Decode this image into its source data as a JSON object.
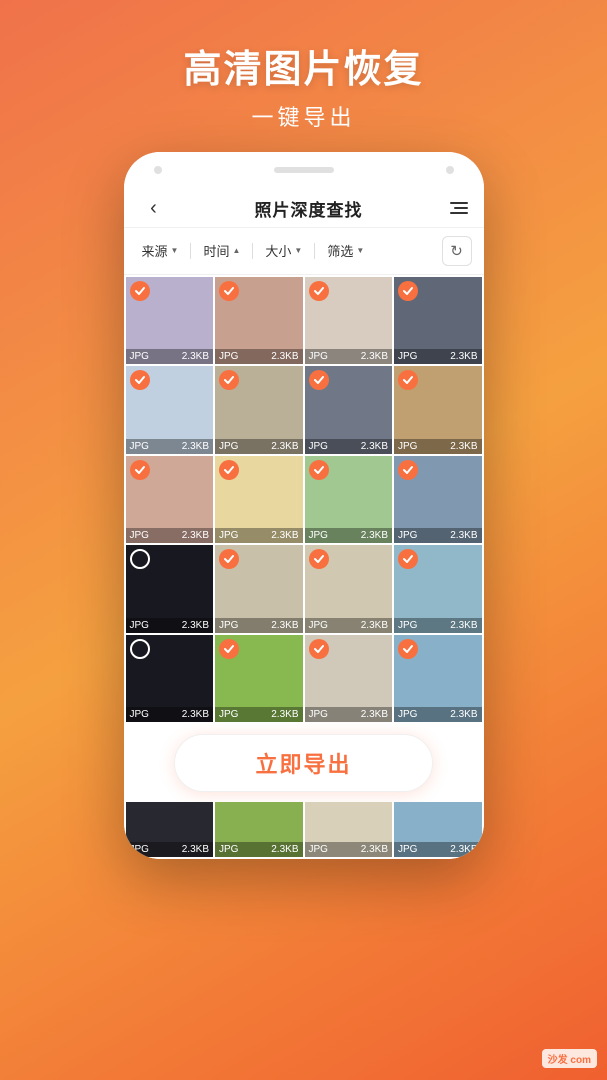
{
  "app": {
    "title": "高清图片恢复",
    "subtitle": "一键导出",
    "header": {
      "back_label": "‹",
      "screen_title": "照片深度查找"
    },
    "filters": [
      {
        "label": "来源",
        "arrow": "▼"
      },
      {
        "label": "时间",
        "arrow": "▲"
      },
      {
        "label": "大小",
        "arrow": "▼"
      },
      {
        "label": "筛选",
        "arrow": "▼"
      }
    ],
    "export_button": "立即导出",
    "grid_items": [
      {
        "checked": true,
        "type": "JPG",
        "size": "2.3KB",
        "color_class": "c2"
      },
      {
        "checked": true,
        "type": "JPG",
        "size": "2.3KB",
        "color_class": "c8"
      },
      {
        "checked": true,
        "type": "JPG",
        "size": "2.3KB",
        "color_class": "c3"
      },
      {
        "checked": true,
        "type": "JPG",
        "size": "2.3KB",
        "color_class": "c4"
      },
      {
        "checked": true,
        "type": "JPG",
        "size": "2.3KB",
        "color_class": "c5"
      },
      {
        "checked": true,
        "type": "JPG",
        "size": "2.3KB",
        "color_class": "c6"
      },
      {
        "checked": true,
        "type": "JPG",
        "size": "2.3KB",
        "color_class": "c7"
      },
      {
        "checked": true,
        "type": "JPG",
        "size": "2.3KB",
        "color_class": "c8"
      },
      {
        "checked": true,
        "type": "JPG",
        "size": "2.3KB",
        "color_class": "c9"
      },
      {
        "checked": true,
        "type": "JPG",
        "size": "2.3KB",
        "color_class": "c10"
      },
      {
        "checked": true,
        "type": "JPG",
        "size": "2.3KB",
        "color_class": "c11"
      },
      {
        "checked": true,
        "type": "JPG",
        "size": "2.3KB",
        "color_class": "c12"
      },
      {
        "checked": false,
        "type": "JPG",
        "size": "2.3KB",
        "color_class": "c13"
      },
      {
        "checked": true,
        "type": "JPG",
        "size": "2.3KB",
        "color_class": "c14"
      },
      {
        "checked": true,
        "type": "JPG",
        "size": "2.3KB",
        "color_class": "c15"
      },
      {
        "checked": true,
        "type": "JPG",
        "size": "2.3KB",
        "color_class": "c16"
      },
      {
        "checked": false,
        "type": "JPG",
        "size": "2.3KB",
        "color_class": "c17"
      },
      {
        "checked": true,
        "type": "JPG",
        "size": "2.3KB",
        "color_class": "c18"
      },
      {
        "checked": true,
        "type": "JPG",
        "size": "2.3KB",
        "color_class": "c19"
      },
      {
        "checked": true,
        "type": "JPG",
        "size": "2.3KB",
        "color_class": "c20"
      }
    ],
    "bottom_items": [
      {
        "checked": false,
        "type": "JPG",
        "size": "2.3KB",
        "color_class": "c4"
      },
      {
        "checked": false,
        "type": "JPG",
        "size": "2.3KB",
        "color_class": "c18"
      },
      {
        "checked": false,
        "type": "JPG",
        "size": "2.3KB",
        "color_class": "c15"
      },
      {
        "checked": false,
        "type": "JPG",
        "size": "2.3KB",
        "color_class": "c20"
      }
    ],
    "watermark": "沙发 com"
  }
}
